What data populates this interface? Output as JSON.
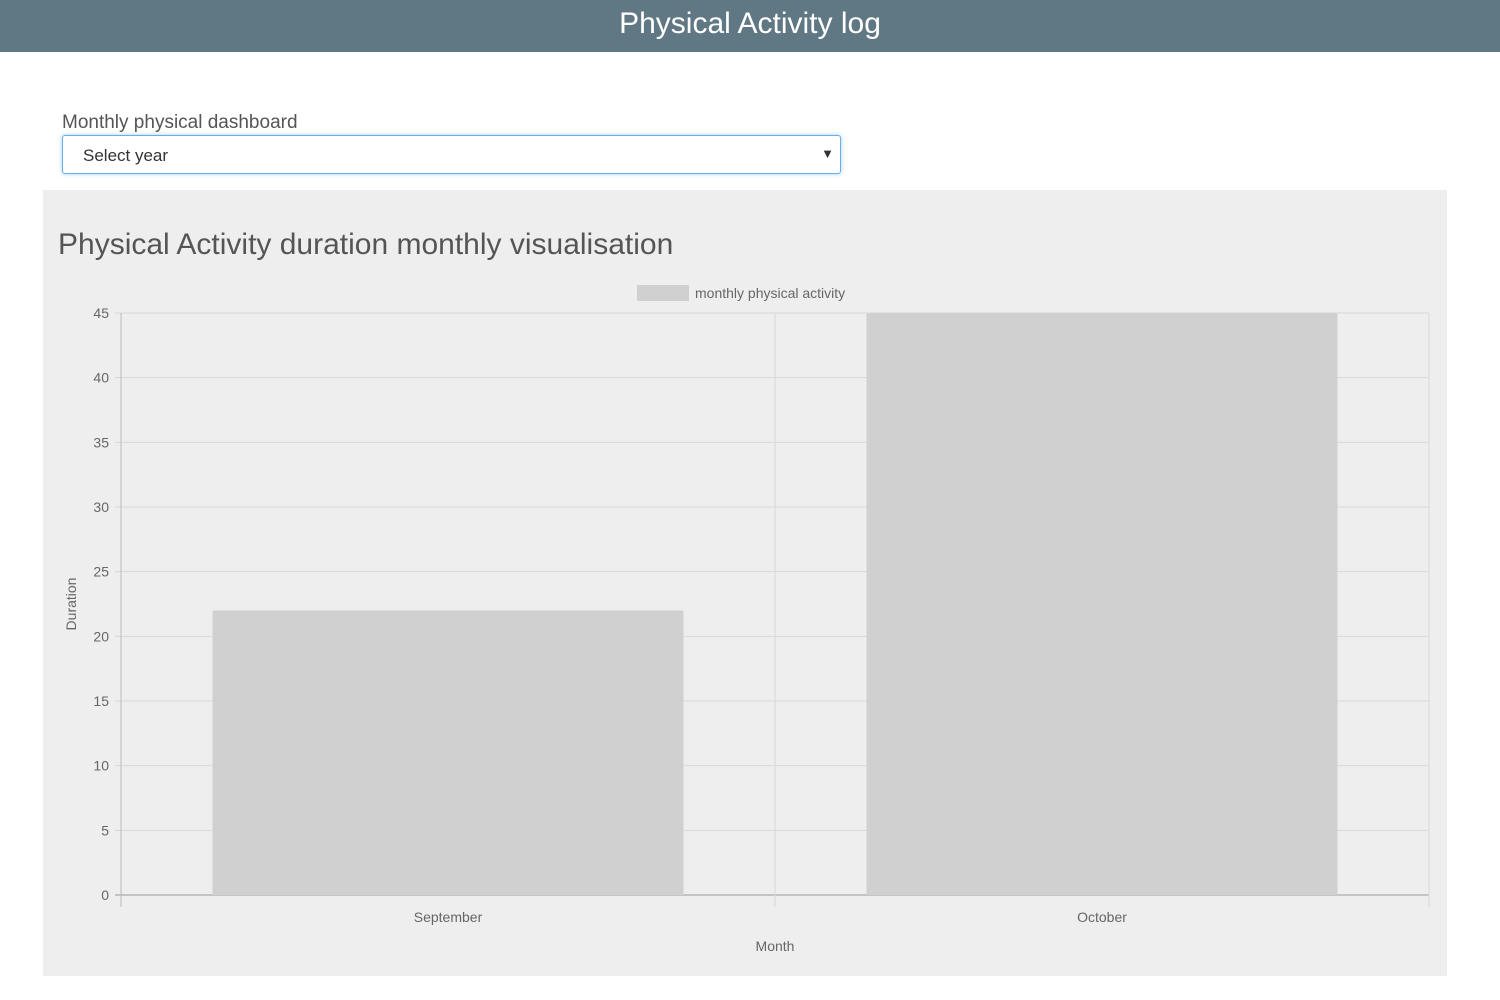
{
  "header": {
    "title": "Physical Activity log"
  },
  "dashboard": {
    "label": "Monthly physical dashboard",
    "select": {
      "selected": "Select year"
    }
  },
  "chart_panel": {
    "title": "Physical Activity duration monthly visualisation"
  },
  "colors": {
    "header_bg": "#607884",
    "bar": "#d0d0d0",
    "panel_bg": "#eeeeee"
  },
  "chart_data": {
    "type": "bar",
    "title": "Physical Activity duration monthly visualisation",
    "categories": [
      "September",
      "October"
    ],
    "series": [
      {
        "name": "monthly physical activity",
        "values": [
          22,
          45
        ]
      }
    ],
    "xlabel": "Month",
    "ylabel": "Duration",
    "ylim": [
      0,
      45
    ],
    "yticks": [
      0,
      5,
      10,
      15,
      20,
      25,
      30,
      35,
      40,
      45
    ],
    "grid": true,
    "legend": "top-center"
  }
}
